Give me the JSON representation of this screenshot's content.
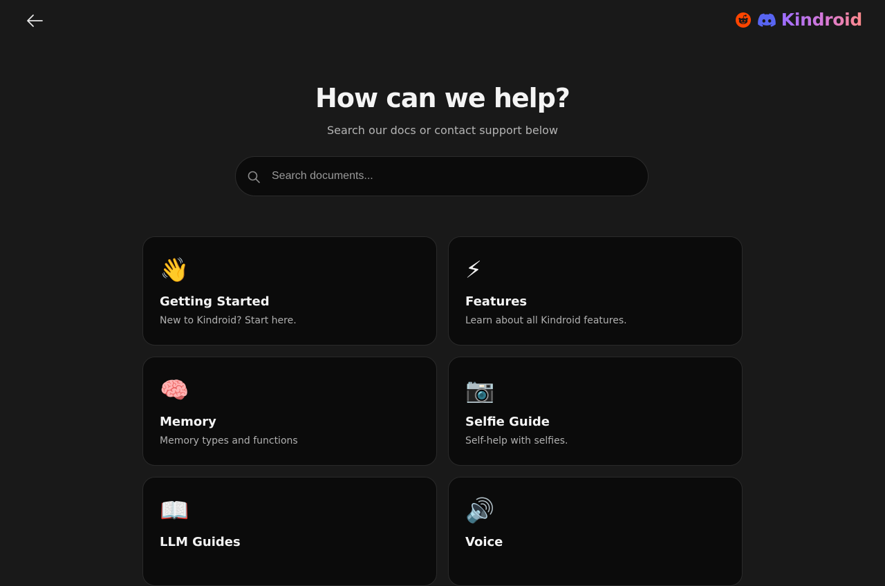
{
  "header": {
    "back_icon": "arrow-left-icon",
    "social_icons": [
      "reddit-icon",
      "discord-icon"
    ],
    "brand_name": "Kindroid",
    "brand_gradient": [
      "#9b6dff",
      "#d879d6",
      "#ff8a8a"
    ],
    "reddit_color": "#ff4500",
    "discord_color": "#5865f2"
  },
  "hero": {
    "title": "How can we help?",
    "subtitle": "Search our docs or contact support below"
  },
  "search": {
    "placeholder": "Search documents...",
    "value": "",
    "icon": "search-icon"
  },
  "cards": [
    {
      "emoji": "👋",
      "icon": "waving-hand-icon",
      "title": "Getting Started",
      "description": "New to Kindroid? Start here."
    },
    {
      "emoji": "⚡",
      "icon": "lightning-icon",
      "title": "Features",
      "description": "Learn about all Kindroid features."
    },
    {
      "emoji": "🧠",
      "icon": "brain-icon",
      "title": "Memory",
      "description": "Memory types and functions"
    },
    {
      "emoji": "📷",
      "icon": "camera-icon",
      "title": "Selfie Guide",
      "description": "Self-help with selfies."
    },
    {
      "emoji": "📖",
      "icon": "open-book-icon",
      "title": "LLM Guides",
      "description": ""
    },
    {
      "emoji": "🔊",
      "icon": "speaker-icon",
      "title": "Voice",
      "description": ""
    }
  ],
  "colors": {
    "background": "#191919",
    "card_background": "#0b0b0b",
    "card_border": "#2a2a2a"
  }
}
